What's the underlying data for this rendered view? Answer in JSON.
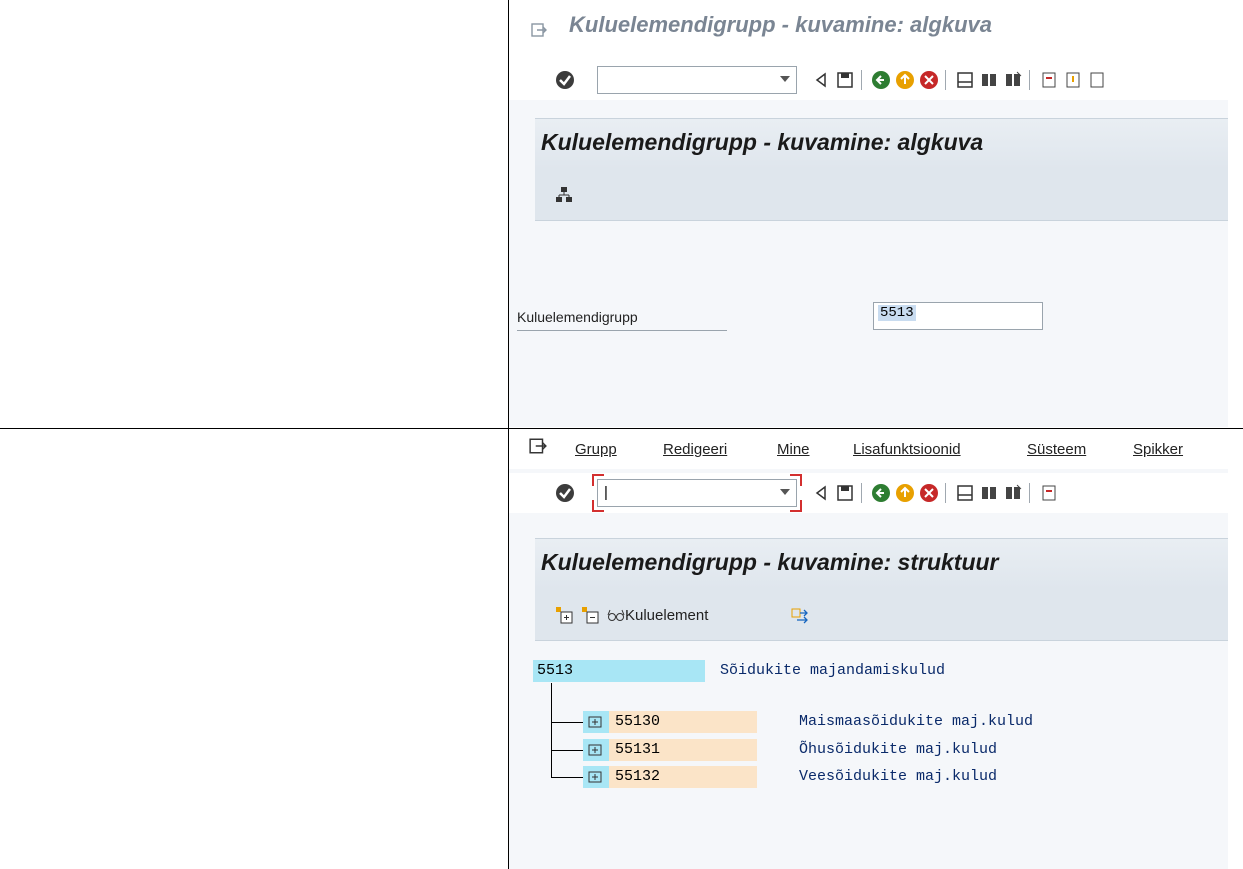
{
  "screen1": {
    "window_title": "Kuluelemendigrupp - kuvamine: algkuva",
    "header_title": "Kuluelemendigrupp - kuvamine: algkuva",
    "field_label": "Kuluelemendigrupp",
    "field_value": "5513"
  },
  "screen2": {
    "menu": [
      "Grupp",
      "Redigeeri",
      "Mine",
      "Lisafunktsioonid",
      "Süsteem",
      "Spikker"
    ],
    "command_value": "|",
    "header_title": "Kuluelemendigrupp - kuvamine: struktuur",
    "toolbar_button_cost_element": "Kuluelement",
    "tree": {
      "root": {
        "key": "5513",
        "desc": "Sõidukite majandamiskulud"
      },
      "children": [
        {
          "key": "55130",
          "desc": "Maismaasõidukite maj.kulud"
        },
        {
          "key": "55131",
          "desc": "Õhusõidukite maj.kulud"
        },
        {
          "key": "55132",
          "desc": "Veesõidukite maj.kulud"
        }
      ]
    }
  },
  "colors": {
    "root_highlight": "#a8e6f5",
    "child_highlight": "#fbe4c8",
    "header_band": "#dfe6ed"
  }
}
